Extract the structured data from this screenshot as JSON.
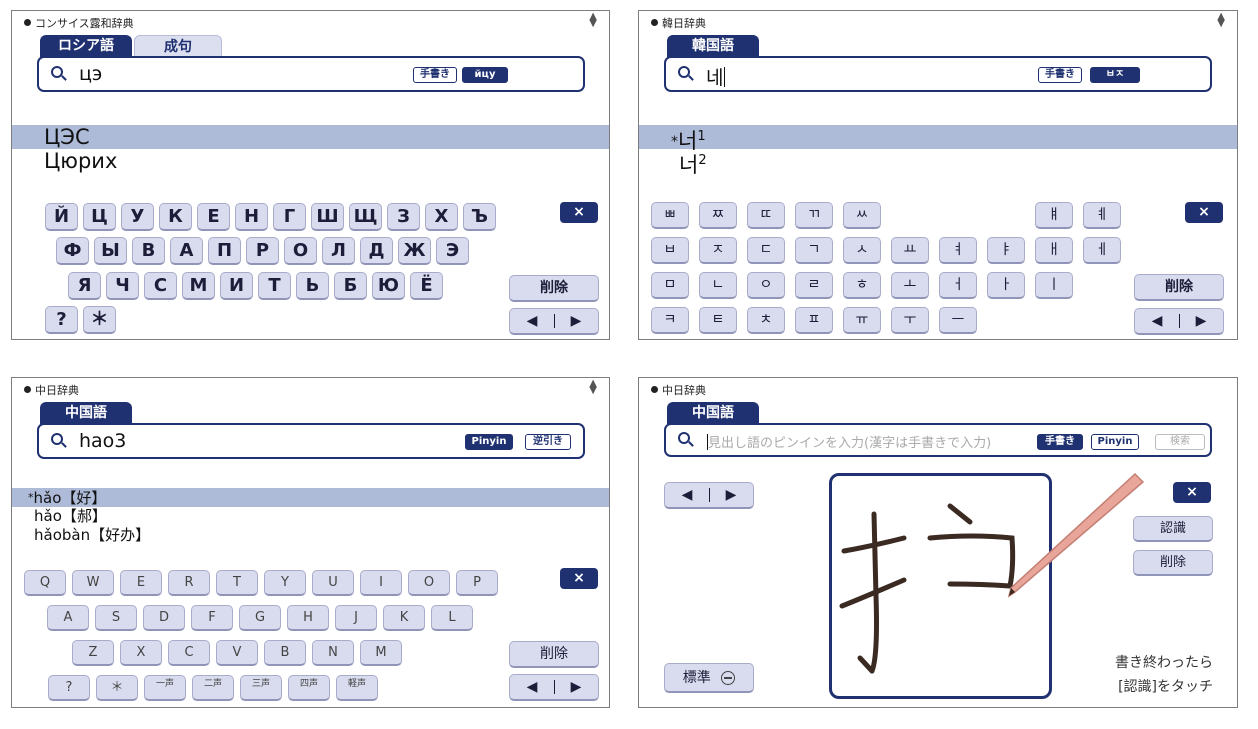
{
  "panel1": {
    "header": "コンサイス露和辞典",
    "tabs": [
      "ロシア語",
      "成句"
    ],
    "search": {
      "value": "цэ",
      "btn_handwriting": "手書き",
      "btn_layout": "йцу"
    },
    "results": [
      "ЦЭС",
      "Цюрих"
    ],
    "keyboard": {
      "rows": [
        [
          "Й",
          "Ц",
          "У",
          "К",
          "Е",
          "Н",
          "Г",
          "Ш",
          "Щ",
          "З",
          "Х",
          "Ъ"
        ],
        [
          "Ф",
          "Ы",
          "В",
          "А",
          "П",
          "Р",
          "О",
          "Л",
          "Д",
          "Ж",
          "Э"
        ],
        [
          "Я",
          "Ч",
          "С",
          "М",
          "И",
          "Т",
          "Ь",
          "Б",
          "Ю",
          "Ё"
        ],
        [
          "?",
          "＊"
        ]
      ],
      "close": "×",
      "delete": "削除",
      "left": "◀",
      "right": "▶"
    }
  },
  "panel2": {
    "header": "韓日辞典",
    "tabs": [
      "韓国語"
    ],
    "search": {
      "value": "네",
      "btn_handwriting": "手書き",
      "btn_layout": "ㅂㅈ"
    },
    "results": [
      {
        "mark": "*",
        "word": "너",
        "sup": "1"
      },
      {
        "mark": "",
        "word": "너",
        "sup": "2"
      }
    ],
    "keyboard": {
      "rows": [
        [
          "ㅃ",
          "ㅉ",
          "ㄸ",
          "ㄲ",
          "ㅆ",
          "",
          "",
          "",
          "ㅒ",
          "ㅖ"
        ],
        [
          "ㅂ",
          "ㅈ",
          "ㄷ",
          "ㄱ",
          "ㅅ",
          "ㅛ",
          "ㅕ",
          "ㅑ",
          "ㅐ",
          "ㅔ"
        ],
        [
          "ㅁ",
          "ㄴ",
          "ㅇ",
          "ㄹ",
          "ㅎ",
          "ㅗ",
          "ㅓ",
          "ㅏ",
          "ㅣ"
        ],
        [
          "ㅋ",
          "ㅌ",
          "ㅊ",
          "ㅍ",
          "ㅠ",
          "ㅜ",
          "ㅡ"
        ]
      ],
      "close": "×",
      "delete": "削除",
      "left": "◀",
      "right": "▶"
    }
  },
  "panel3": {
    "header": "中日辞典",
    "tabs": [
      "中国語"
    ],
    "search": {
      "value": "hao3",
      "btn_pinyin": "Pinyin",
      "btn_reverse": "逆引き"
    },
    "results": [
      {
        "mark": "*",
        "pinyin": "hǎo",
        "hanzi": "【好】"
      },
      {
        "mark": "",
        "pinyin": "hǎo",
        "hanzi": "【郝】"
      },
      {
        "mark": "",
        "pinyin": "hǎobàn",
        "hanzi": "【好办】"
      }
    ],
    "keyboard": {
      "rows": [
        [
          "Q",
          "W",
          "E",
          "R",
          "T",
          "Y",
          "U",
          "I",
          "O",
          "P"
        ],
        [
          "A",
          "S",
          "D",
          "F",
          "G",
          "H",
          "J",
          "K",
          "L"
        ],
        [
          "Z",
          "X",
          "C",
          "V",
          "B",
          "N",
          "M"
        ],
        [
          "?",
          "＊",
          "一声",
          "二声",
          "三声",
          "四声",
          "軽声"
        ]
      ],
      "close": "×",
      "delete": "削除",
      "left": "◀",
      "right": "▶"
    }
  },
  "panel4": {
    "header": "中日辞典",
    "tabs": [
      "中国語"
    ],
    "search": {
      "placeholder": "見出し語のピンインを入力(漢字は手書きで入力)",
      "btn_handwriting": "手書き",
      "btn_pinyin": "Pinyin",
      "btn_search": "検索"
    },
    "left": "◀",
    "right": "▶",
    "close": "×",
    "recognize": "認識",
    "delete": "削除",
    "zoom": "標準",
    "note_line1": "書き終わったら",
    "note_line2": "[認識]をタッチ"
  }
}
